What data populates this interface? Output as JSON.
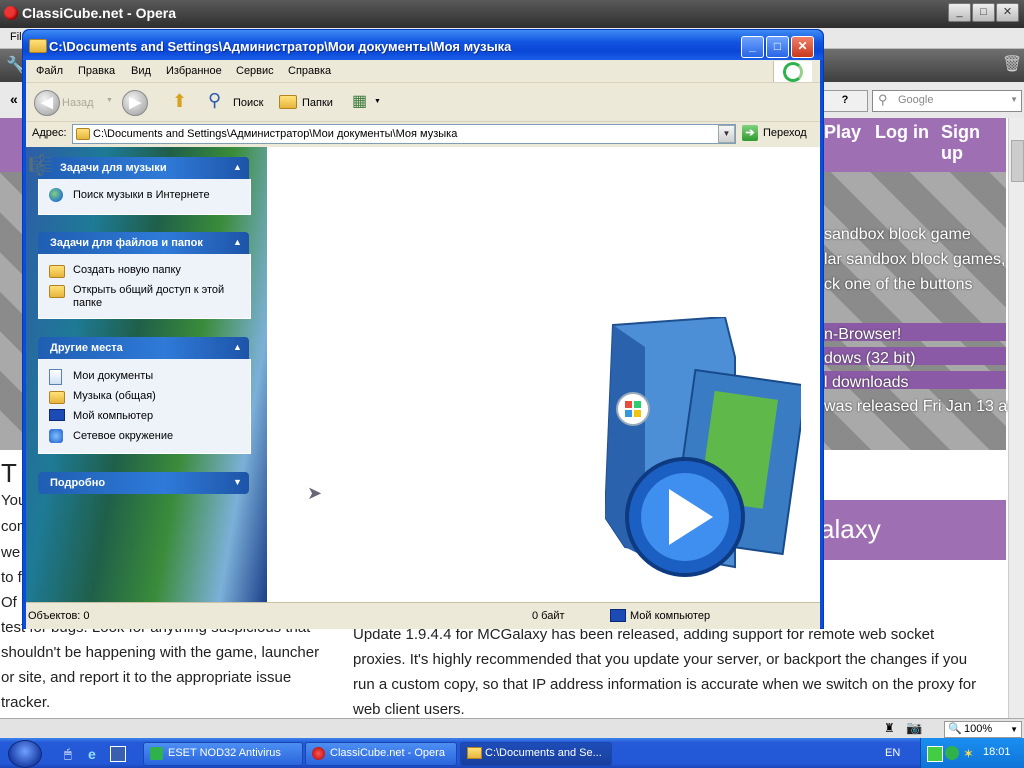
{
  "opera": {
    "title": "ClassiCube.net - Opera",
    "menu_first": "Fil",
    "search_placeholder": "Google",
    "help_label": "?",
    "zoom": "100%",
    "minimize": "_",
    "maximize": "□",
    "close": "✕"
  },
  "website": {
    "nav": {
      "play": "Play",
      "login": "Log in",
      "signup": "Sign up"
    },
    "hero_lines": [
      "sandbox block game",
      "lar sandbox block games,",
      "ck one of the buttons",
      "n-Browser!",
      "dows (32 bit)",
      "l downloads",
      "was released Fri Jan 13 at"
    ],
    "galaxy_heading": "alaxy",
    "left_heading": "T",
    "left_column": [
      "You",
      "com",
      "we",
      "to f",
      "Of",
      "test for bugs. Look for anything suspicious that",
      "shouldn't be happening with the game, launcher",
      "or site, and report it to the appropriate issue",
      "tracker."
    ],
    "right_column": [
      "Update 1.9.4.4 for MCGalaxy has been released, adding support for remote web socket",
      "proxies. It's highly recommended that you update your server, or backport the changes if you",
      "run a custom copy, so that IP address information is accurate when we switch on the proxy for",
      "web client users."
    ]
  },
  "explorer": {
    "title": "C:\\Documents and Settings\\Администратор\\Мои документы\\Моя музыка",
    "menu": [
      "Файл",
      "Правка",
      "Вид",
      "Избранное",
      "Сервис",
      "Справка"
    ],
    "toolbar": {
      "back": "Назад",
      "search": "Поиск",
      "folders": "Папки"
    },
    "address_label": "Адрес:",
    "address_value": "C:\\Documents and Settings\\Администратор\\Мои документы\\Моя музыка",
    "go_label": "Переход",
    "groups": [
      {
        "title": "Задачи для музыки",
        "items": [
          "Поиск музыки в Интернете"
        ]
      },
      {
        "title": "Задачи для файлов и папок",
        "items": [
          "Создать новую папку",
          "Открыть общий доступ к этой",
          "папке"
        ]
      },
      {
        "title": "Другие места",
        "items": [
          "Мои документы",
          "Музыка (общая)",
          "Мой компьютер",
          "Сетевое окружение"
        ]
      },
      {
        "title": "Подробно",
        "items": []
      }
    ],
    "status": {
      "objects": "Объектов: 0",
      "size": "0 байт",
      "location": "Мой компьютер"
    }
  },
  "taskbar": {
    "buttons": [
      "ESET NOD32 Antivirus",
      "ClassiCube.net - Opera",
      "C:\\Documents and Se..."
    ],
    "lang": "EN",
    "clock": "18:01"
  },
  "colors": {
    "site_purple": "#9f6fb3",
    "xp_blue": "#0a4ddb",
    "taskbar_blue": "#2258d6"
  }
}
